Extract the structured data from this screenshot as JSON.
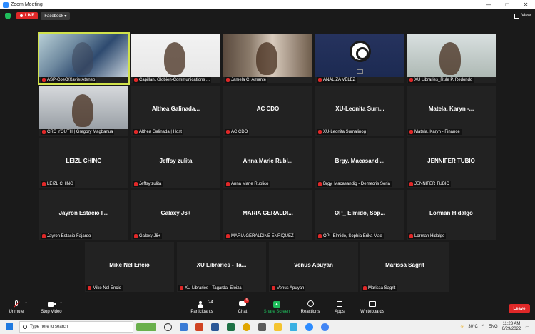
{
  "window": {
    "title": "Zoom Meeting",
    "controls": [
      "—",
      "□",
      "✕"
    ]
  },
  "topbar": {
    "live_label": "LIVE",
    "platform_label": "Facebook ▾",
    "view_label": "View"
  },
  "participants": [
    {
      "label": "ASP-CoeO/XavierAteneo",
      "display": "",
      "video": "v1",
      "active": true
    },
    {
      "label": "Capillan, Globien-Communications ...",
      "display": "",
      "video": "v2"
    },
    {
      "label": "Jamela C. Amante",
      "display": "",
      "video": "v3"
    },
    {
      "label": "ANALIZA VELEZ",
      "display": "",
      "video": "v4"
    },
    {
      "label": "XU Libraries_Rule P. Redondo",
      "display": "",
      "video": "v5"
    },
    {
      "label": "CRO YOUTH | Gregory Magbanua",
      "display": "",
      "video": "v6"
    },
    {
      "label": "Althea Galinada | Host",
      "display": "Althea Galinada..."
    },
    {
      "label": "AC CDO",
      "display": "AC CDO"
    },
    {
      "label": "XU-Leonita Sumalinog",
      "display": "XU-Leonita Sum..."
    },
    {
      "label": "Matela, Karyn - Finance",
      "display": "Matela, Karyn -..."
    },
    {
      "label": "LEIZL CHING",
      "display": "LEIZL CHING"
    },
    {
      "label": "Jeffsy zulita",
      "display": "Jeffsy zulita"
    },
    {
      "label": "Anna Marie Rublico",
      "display": "Anna Marie Rubl..."
    },
    {
      "label": "Brgy. Macasandig - Demecris Soria",
      "display": "Brgy. Macasandi..."
    },
    {
      "label": "JENNIFER TUBIO",
      "display": "JENNIFER TUBIO"
    },
    {
      "label": "Jayron Estacio Fajardo",
      "display": "Jayron Estacio F..."
    },
    {
      "label": "Galaxy J6+",
      "display": "Galaxy J6+"
    },
    {
      "label": "MARIA GERALDINE ENRIQUEZ",
      "display": "MARIA GERALDI..."
    },
    {
      "label": "OP_ Elmido, Sophia Erika Mae",
      "display": "OP_ Elmido, Sop..."
    },
    {
      "label": "Lorman Hidalgo",
      "display": "Lorman Hidalgo"
    },
    {
      "label": "Mike Nel Encio",
      "display": "Mike Nel Encio"
    },
    {
      "label": "XU Libraries - Tagarda, Eloiza",
      "display": "XU Libraries - Ta..."
    },
    {
      "label": "Venus Apuyan",
      "display": "Venus Apuyan"
    },
    {
      "label": "Marissa Sagrit",
      "display": "Marissa Sagrit"
    }
  ],
  "toolbar": {
    "unmute": "Unmute",
    "stop_video": "Stop Video",
    "participants": "Participants",
    "participants_count": "24",
    "chat": "Chat",
    "chat_badge": "4",
    "share_screen": "Share Screen",
    "reactions": "Reactions",
    "apps": "Apps",
    "whiteboards": "Whiteboards",
    "leave": "Leave",
    "caret": "^"
  },
  "taskbar": {
    "search_placeholder": "Type here to search",
    "weather": "30°C",
    "lang": "ENG",
    "time": "11:23 AM",
    "date": "6/29/2022"
  },
  "colors": {
    "accent_green": "#1fbd5c",
    "live_red": "#e02828",
    "active_border": "#d1e24b"
  }
}
